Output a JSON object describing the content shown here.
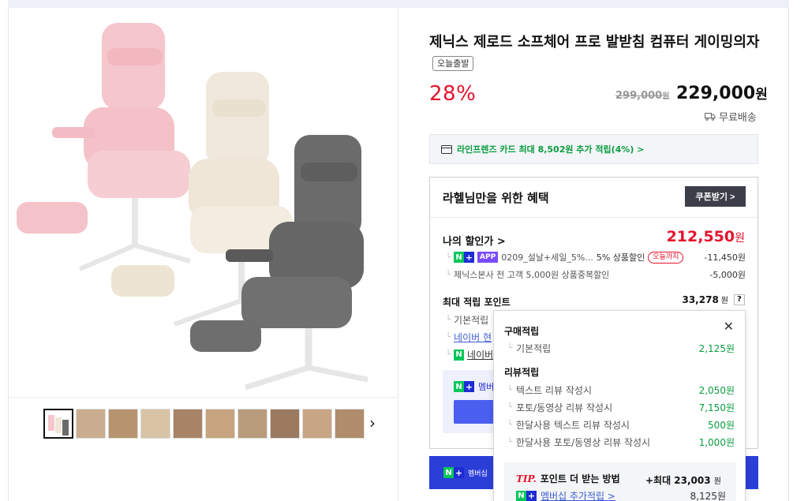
{
  "product": {
    "title": "제닉스 제로드 소프체어 프로 발받침 컴퓨터 게이밍의자",
    "tag": "오늘출발",
    "discount": "28%",
    "original_price": "299,000",
    "original_unit": "원",
    "price": "229,000",
    "price_unit": "원",
    "shipping": "무료배송"
  },
  "card_promo": "라인프렌즈 카드 최대 8,502원 추가 적립(4%) >",
  "benefit": {
    "title": "라헬님만을 위한 혜택",
    "coupon_button": "쿠폰받기 >",
    "my_discount_label": "나의 할인가 >",
    "my_discount_value": "212,550",
    "my_discount_unit": "원",
    "discount_rows": [
      {
        "app": "APP",
        "text": "0209_설날+세일_5%...",
        "rate": "5% 상품할인",
        "badge": "오늘까지",
        "amount": "-11,450원"
      },
      {
        "text": "제닉스본사 전 고객 5,000원 상품중복할인",
        "amount": "-5,000원"
      }
    ],
    "max_points_label": "최대 적립 포인트",
    "max_points_value": "33,278",
    "max_points_unit": "원",
    "qmark": "?",
    "left_rows": [
      "기본적립",
      "네이버 현",
      "네이버"
    ],
    "member_text": "멤버"
  },
  "bottom_bar_text": "멤버십",
  "tooltip": {
    "close": "✕",
    "purchase_header": "구매적립",
    "purchase_rows": [
      {
        "label": "기본적립",
        "value": "2,125원"
      }
    ],
    "review_header": "리뷰적립",
    "review_rows": [
      {
        "label": "텍스트 리뷰 작성시",
        "value": "2,050원"
      },
      {
        "label": "포토/동영상 리뷰 작성시",
        "value": "7,150원"
      },
      {
        "label": "한달사용 텍스트 리뷰 작성시",
        "value": "500원"
      },
      {
        "label": "한달사용 포토/동영상 리뷰 작성시",
        "value": "1,000원"
      }
    ],
    "tip_mark": "TIP.",
    "tip_title": "포인트 더 받는 방법",
    "tip_max": "+최대 23,003",
    "tip_max_unit": "원",
    "tip_member_label": "멤버십 추가적립 >",
    "tip_member_value": "8,125원"
  },
  "colors": {
    "accent_red": "#e4142c",
    "green": "#03c75a",
    "naver_plus_blue": "#1e2bd6",
    "coupon_dark": "#3c3f4a"
  },
  "icons": {
    "card": "card-icon",
    "truck": "truck-icon",
    "next": "chevron-right-icon",
    "close": "close-icon"
  }
}
